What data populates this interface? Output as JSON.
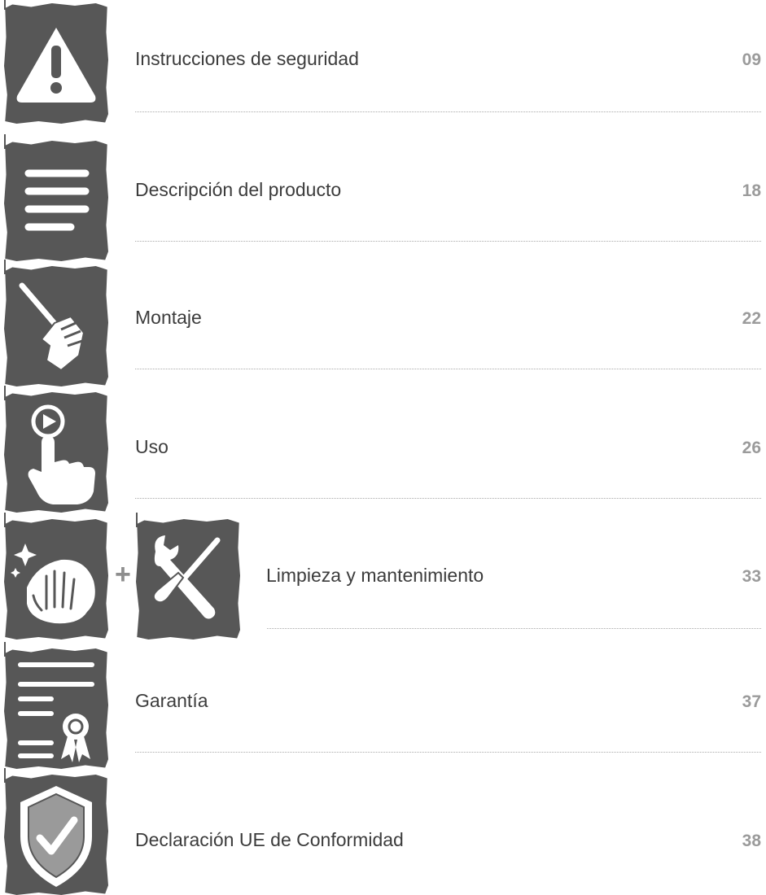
{
  "toc": [
    {
      "title": "Instrucciones de seguridad",
      "page": "09",
      "icon": "warning-triangle-icon"
    },
    {
      "title": "Descripción del producto",
      "page": "18",
      "icon": "text-lines-icon"
    },
    {
      "title": "Montaje",
      "page": "22",
      "icon": "hand-screwdriver-icon"
    },
    {
      "title": "Uso",
      "page": "26",
      "icon": "hand-tap-play-icon"
    },
    {
      "title": "Limpieza y mantenimiento",
      "page": "33",
      "icons": [
        "hand-cloth-cleaning-icon",
        "wrench-screwdriver-icon"
      ],
      "joiner": "+"
    },
    {
      "title": "Garantía",
      "page": "37",
      "icon": "certificate-ribbon-icon"
    },
    {
      "title": "Declaración UE de Conformidad",
      "page": "38",
      "icon": "shield-check-icon"
    }
  ],
  "colors": {
    "icon_background": "#575757",
    "icon_foreground": "#ffffff",
    "title_text": "#3c3c3c",
    "page_number": "#9b9b9b",
    "divider": "#a9a9a9"
  }
}
